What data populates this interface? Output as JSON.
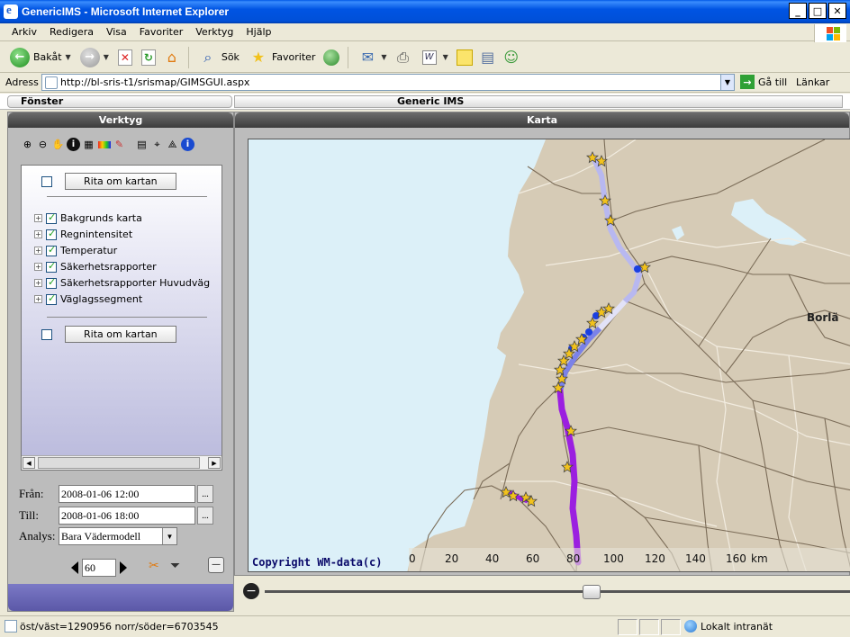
{
  "window": {
    "title": "GenericIMS - Microsoft Internet Explorer",
    "minimize": "_",
    "maximize": "□",
    "close": "✕"
  },
  "menu": [
    "Arkiv",
    "Redigera",
    "Visa",
    "Favoriter",
    "Verktyg",
    "Hjälp"
  ],
  "toolbar": {
    "back": "Bakåt",
    "search": "Sök",
    "favorites": "Favoriter"
  },
  "address": {
    "label": "Adress",
    "url": "http://bl-sris-t1/srismap/GIMSGUI.aspx",
    "go": "Gå till",
    "links": "Länkar"
  },
  "app": {
    "window_menu": "Fönster",
    "title": "Generic IMS"
  },
  "tools_panel": {
    "title": "Verktyg",
    "redraw_label": "Rita om kartan",
    "layers": [
      {
        "label": "Bakgrunds karta",
        "checked": true
      },
      {
        "label": "Regnintensitet",
        "checked": true
      },
      {
        "label": "Temperatur",
        "checked": true
      },
      {
        "label": "Säkerhetsrapporter",
        "checked": true
      },
      {
        "label": "Säkerhetsrapporter Huvudväg",
        "checked": true
      },
      {
        "label": "Väglagssegment",
        "checked": true
      }
    ],
    "from_label": "Från:",
    "from_value": "2008-01-06 12:00",
    "to_label": "Till:",
    "to_value": "2008-01-06 18:00",
    "analysis_label": "Analys:",
    "analysis_value": "Bara Vädermodell",
    "step_value": "60",
    "browse": "..."
  },
  "map_panel": {
    "title": "Karta",
    "copyright": "Copyright WM-data(c)",
    "scale_ticks": [
      "0",
      "20",
      "40",
      "60",
      "80",
      "100",
      "120",
      "140",
      "160"
    ],
    "scale_unit": "km",
    "city_label": "Borlä",
    "zoom_level": 0.56
  },
  "status": {
    "coords": "öst/väst=1290956 norr/söder=6703545",
    "zone": "Lokalt intranät"
  },
  "colors": {
    "sea": "#dcf0f8",
    "land": "#d6cbb6",
    "road": "#7b6c58",
    "route_light": "#b8b8f0",
    "route_purple": "#9b1fe0",
    "marker_star": "#f2c21c",
    "marker_blue": "#1a3fe0"
  }
}
